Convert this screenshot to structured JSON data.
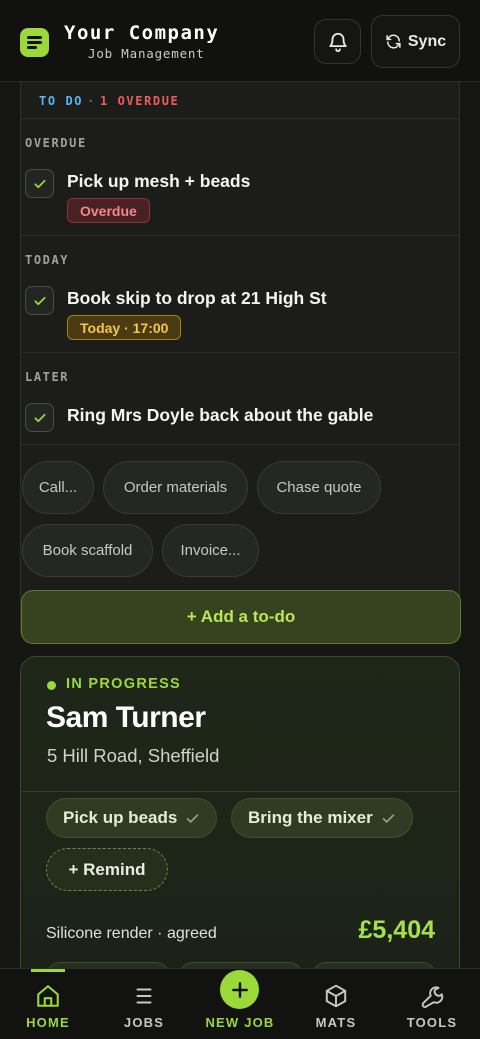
{
  "header": {
    "brand_name": "Your Company",
    "brand_sub": "Job Management",
    "sync_label": "Sync",
    "logo_icon": "list-icon",
    "bell_icon": "bell-icon",
    "sync_icon": "refresh-icon"
  },
  "todo": {
    "header_label": "TO DO",
    "header_sep": "·",
    "overdue_count_label": "1 OVERDUE",
    "sections": [
      {
        "label": "OVERDUE",
        "task": "Pick up mesh + beads",
        "badge": "Overdue"
      },
      {
        "label": "TODAY",
        "task": "Book skip to drop at 21 High St",
        "badge": "Today · 17:00"
      },
      {
        "label": "LATER",
        "task": "Ring Mrs Doyle back about the gable"
      }
    ],
    "quick_chips": [
      "Call...",
      "Order materials",
      "Chase quote",
      "Book scaffold",
      "Invoice..."
    ],
    "add_label": "+ Add a to-do"
  },
  "job": {
    "status": "IN PROGRESS",
    "client": "Sam Turner",
    "address": "5 Hill Road, Sheffield",
    "tasks": [
      "Pick up beads",
      "Bring the mixer"
    ],
    "remind_label": "+ Remind",
    "price_label": "Silicone render · agreed",
    "price": "£5,404"
  },
  "nav": {
    "items": [
      {
        "label": "HOME",
        "icon": "home-icon",
        "active": true
      },
      {
        "label": "JOBS",
        "icon": "menu-icon"
      },
      {
        "label": "NEW JOB",
        "icon": "plus-icon"
      },
      {
        "label": "MATS",
        "icon": "box-icon"
      },
      {
        "label": "TOOLS",
        "icon": "wrench-icon"
      }
    ]
  },
  "colors": {
    "accent": "#9bd83a",
    "todo_blue": "#57b7f0",
    "overdue_red": "#ef5a5a",
    "today_amber": "#f4c64a"
  }
}
